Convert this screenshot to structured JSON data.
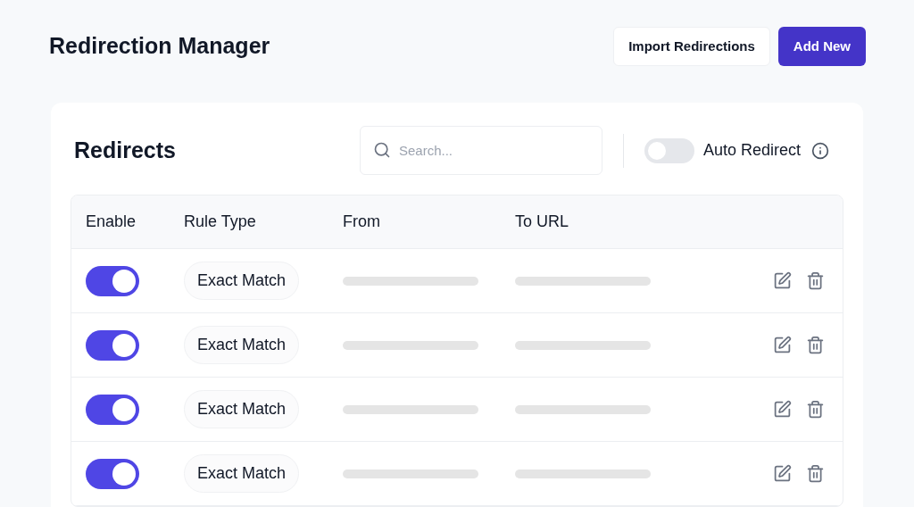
{
  "page": {
    "title": "Redirection Manager"
  },
  "header_buttons": [
    "Import Redirections",
    "Add New"
  ],
  "card": {
    "title": "Redirects",
    "search": {
      "placeholder": "Search..."
    },
    "auto_redirect": {
      "label": "Auto Redirect",
      "on": false
    }
  },
  "table": {
    "columns": [
      "Enable",
      "Rule Type",
      "From",
      "To URL"
    ],
    "rows": [
      {
        "enabled": true,
        "rule_type": "Exact Match"
      },
      {
        "enabled": true,
        "rule_type": "Exact Match"
      },
      {
        "enabled": true,
        "rule_type": "Exact Match"
      },
      {
        "enabled": true,
        "rule_type": "Exact Match"
      }
    ]
  }
}
